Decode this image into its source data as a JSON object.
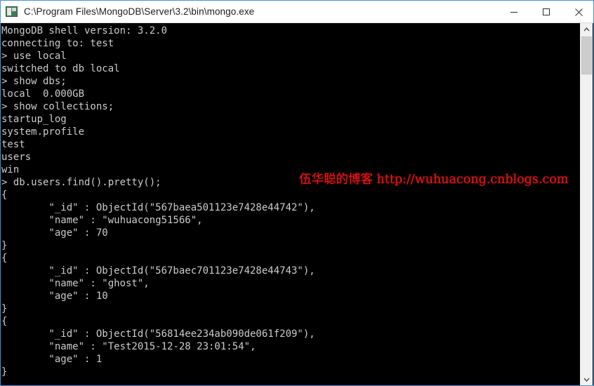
{
  "window": {
    "title": "C:\\Program Files\\MongoDB\\Server\\3.2\\bin\\mongo.exe",
    "icon": "console-icon",
    "border_color": "#4a90d9",
    "titlebar_bg": "#ffffff",
    "console_bg": "#000000",
    "console_fg": "#cccccc"
  },
  "controls": {
    "minimize_label": "Minimize",
    "maximize_label": "Maximize",
    "close_label": "Close"
  },
  "console": {
    "lines": [
      "MongoDB shell version: 3.2.0",
      "connecting to: test",
      "> use local",
      "switched to db local",
      "> show dbs;",
      "local  0.000GB",
      "> show collections;",
      "startup_log",
      "system.profile",
      "test",
      "users",
      "win",
      "> db.users.find().pretty();",
      "{",
      "        \"_id\" : ObjectId(\"567baea501123e7428e44742\"),",
      "        \"name\" : \"wuhuacong51566\",",
      "        \"age\" : 70",
      "}",
      "{",
      "        \"_id\" : ObjectId(\"567baec701123e7428e44743\"),",
      "        \"name\" : \"ghost\",",
      "        \"age\" : 10",
      "}",
      "{",
      "        \"_id\" : ObjectId(\"56814ee234ab090de061f209\"),",
      "        \"name\" : \"Test2015-12-28 23:01:54\",",
      "        \"age\" : 1",
      "}"
    ],
    "text": "MongoDB shell version: 3.2.0\nconnecting to: test\n> use local\nswitched to db local\n> show dbs;\nlocal  0.000GB\n> show collections;\nstartup_log\nsystem.profile\ntest\nusers\nwin\n> db.users.find().pretty();\n{\n        \"_id\" : ObjectId(\"567baea501123e7428e44742\"),\n        \"name\" : \"wuhuacong51566\",\n        \"age\" : 70\n}\n{\n        \"_id\" : ObjectId(\"567baec701123e7428e44743\"),\n        \"name\" : \"ghost\",\n        \"age\" : 10\n}\n{\n        \"_id\" : ObjectId(\"56814ee234ab090de061f209\"),\n        \"name\" : \"Test2015-12-28 23:01:54\",\n        \"age\" : 1\n}"
  },
  "watermark": {
    "text": "伍华聪的博客 http://wuhuacong.cnblogs.com",
    "color": "#e01b1b"
  },
  "scrollbar": {
    "up_arrow": "chevron-up-icon",
    "down_arrow": "chevron-down-icon",
    "thumb_label": "scrollbar-thumb"
  }
}
